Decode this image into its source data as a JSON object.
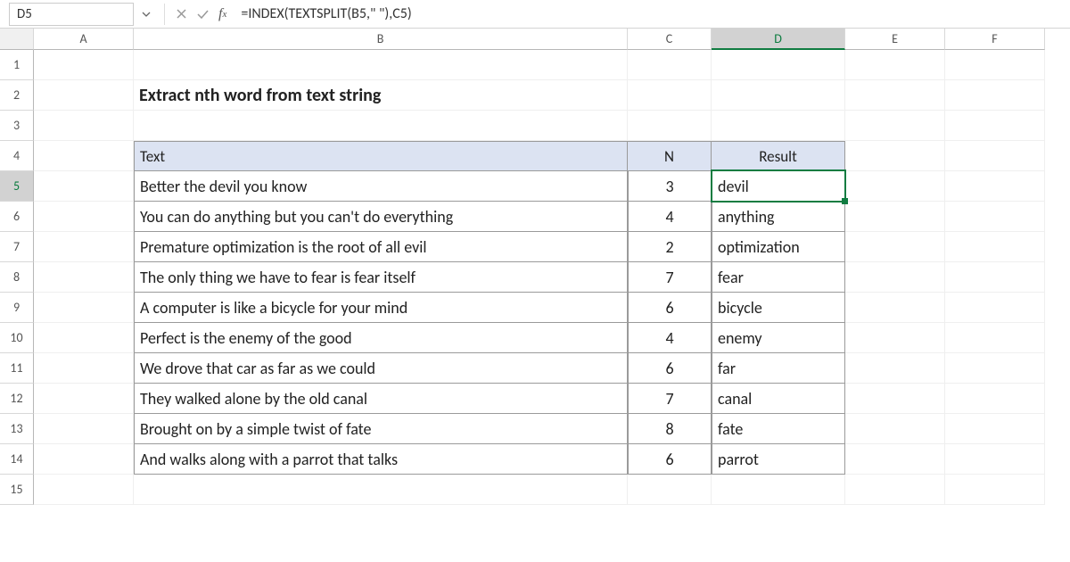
{
  "namebox": {
    "value": "D5"
  },
  "formula_bar": {
    "formula": "=INDEX(TEXTSPLIT(B5,\" \"),C5)"
  },
  "columns": [
    "A",
    "B",
    "C",
    "D",
    "E",
    "F"
  ],
  "selected_column": "D",
  "selected_row": "5",
  "row_numbers": [
    "1",
    "2",
    "3",
    "4",
    "5",
    "6",
    "7",
    "8",
    "9",
    "10",
    "11",
    "12",
    "13",
    "14",
    "15"
  ],
  "title": "Extract nth word from text string",
  "table": {
    "headers": {
      "text": "Text",
      "n": "N",
      "result": "Result"
    },
    "rows": [
      {
        "text": "Better the devil you know",
        "n": "3",
        "result": "devil"
      },
      {
        "text": "You can do anything but you can't do everything",
        "n": "4",
        "result": "anything"
      },
      {
        "text": "Premature optimization is the root of all evil",
        "n": "2",
        "result": "optimization"
      },
      {
        "text": "The only thing we have to fear is fear itself",
        "n": "7",
        "result": "fear"
      },
      {
        "text": "A computer is like a bicycle for your mind",
        "n": "6",
        "result": "bicycle"
      },
      {
        "text": "Perfect is the enemy of the good",
        "n": "4",
        "result": "enemy"
      },
      {
        "text": "We drove that car as far as we could",
        "n": "6",
        "result": "far"
      },
      {
        "text": "They walked alone by the old canal",
        "n": "7",
        "result": "canal"
      },
      {
        "text": "Brought on by a simple twist of fate",
        "n": "8",
        "result": "fate"
      },
      {
        "text": "And walks along with a parrot that talks",
        "n": "6",
        "result": "parrot"
      }
    ]
  }
}
